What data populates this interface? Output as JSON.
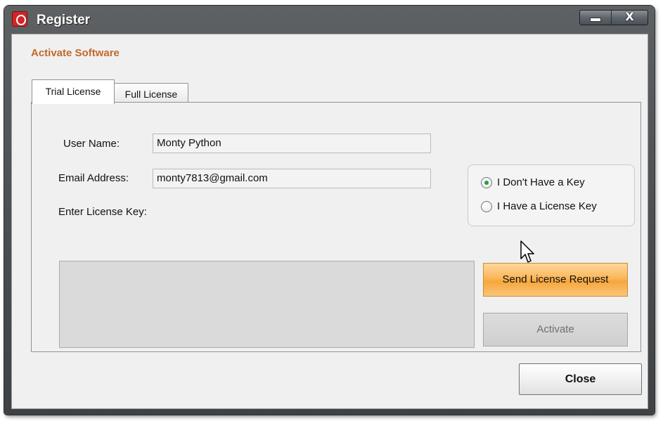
{
  "window": {
    "title": "Register",
    "minimize_label": "",
    "close_glyph": "X"
  },
  "header": {
    "section_title": "Activate Software"
  },
  "tabs": [
    {
      "label": "Trial License",
      "active": true
    },
    {
      "label": "Full License",
      "active": false
    }
  ],
  "form": {
    "user_name_label": "User Name:",
    "user_name_value": "Monty Python",
    "email_label": "Email Address:",
    "email_value": "monty7813@gmail.com",
    "license_key_label": "Enter License Key:",
    "license_key_value": ""
  },
  "options": {
    "items": [
      {
        "label": "I Don't Have a Key",
        "selected": true
      },
      {
        "label": "I Have a License Key",
        "selected": false
      }
    ]
  },
  "buttons": {
    "send_request_label": "Send License Request",
    "activate_label": "Activate",
    "close_label": "Close"
  },
  "colors": {
    "accent_orange": "#c2692a",
    "radio_selected": "#2e9a3a",
    "send_button_fill": "#fbb75a"
  },
  "icons": {
    "app_icon": "app-o-logo-icon",
    "cursor": "pointer-cursor-icon"
  }
}
